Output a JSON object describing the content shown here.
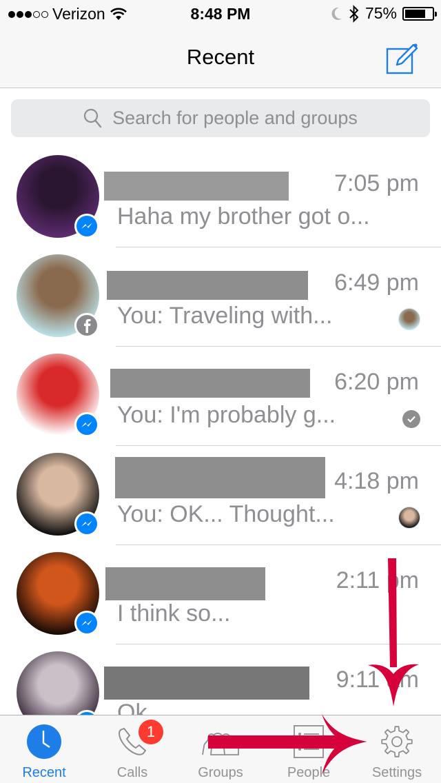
{
  "status_bar": {
    "signal_bars_filled": 3,
    "signal_bars_total": 5,
    "carrier": "Verizon",
    "time": "8:48 PM",
    "battery": "75%",
    "battery_level": 0.75,
    "icons": [
      "wifi-icon",
      "moon-icon",
      "bluetooth-icon",
      "battery-icon"
    ]
  },
  "nav": {
    "title": "Recent",
    "compose_icon": "compose-icon"
  },
  "search": {
    "placeholder": "Search for people and groups",
    "icon": "search-icon"
  },
  "conversations": [
    {
      "name": "[redacted]",
      "time": "7:05 pm",
      "preview": "Haha my brother got o...",
      "platform": "messenger",
      "status": "none",
      "colors": [
        "#5b2a6e",
        "#2a1630"
      ]
    },
    {
      "name": "[redacted]",
      "time": "6:49 pm",
      "preview": "You: Traveling with...",
      "platform": "facebook",
      "status": "seen-avatar",
      "colors": [
        "#b9dfe6",
        "#8a6a4e"
      ]
    },
    {
      "name": "[redacted]",
      "time": "6:20 pm",
      "preview": "You: I'm probably g...",
      "platform": "messenger",
      "status": "delivered-check",
      "colors": [
        "#ffffff",
        "#d82a2a"
      ]
    },
    {
      "name": "[redacted]",
      "time": "4:18 pm",
      "preview": "You: OK... Thought...",
      "platform": "messenger",
      "status": "seen-avatar",
      "colors": [
        "#111111",
        "#d8b8a0"
      ]
    },
    {
      "name": "[redacted]",
      "time": "2:11 pm",
      "preview": "I think so...",
      "platform": "messenger",
      "status": "none",
      "colors": [
        "#1a0c05",
        "#d0561c"
      ]
    },
    {
      "name": "[redacted]",
      "time": "9:11 am",
      "preview": "Ok",
      "platform": "messenger",
      "status": "none",
      "colors": [
        "#3a2a3a",
        "#c9c0c8"
      ]
    }
  ],
  "tab_bar": {
    "active": "Recent",
    "tabs": [
      {
        "label": "Recent",
        "icon": "clock-icon"
      },
      {
        "label": "Calls",
        "icon": "phone-icon",
        "badge": "1"
      },
      {
        "label": "Groups",
        "icon": "groups-icon"
      },
      {
        "label": "People",
        "icon": "people-list-icon"
      },
      {
        "label": "Settings",
        "icon": "gear-icon"
      }
    ]
  },
  "annotations": {
    "color": "#d6003a",
    "arrows": [
      "arrow-down-to-settings",
      "arrow-right-to-settings"
    ]
  }
}
